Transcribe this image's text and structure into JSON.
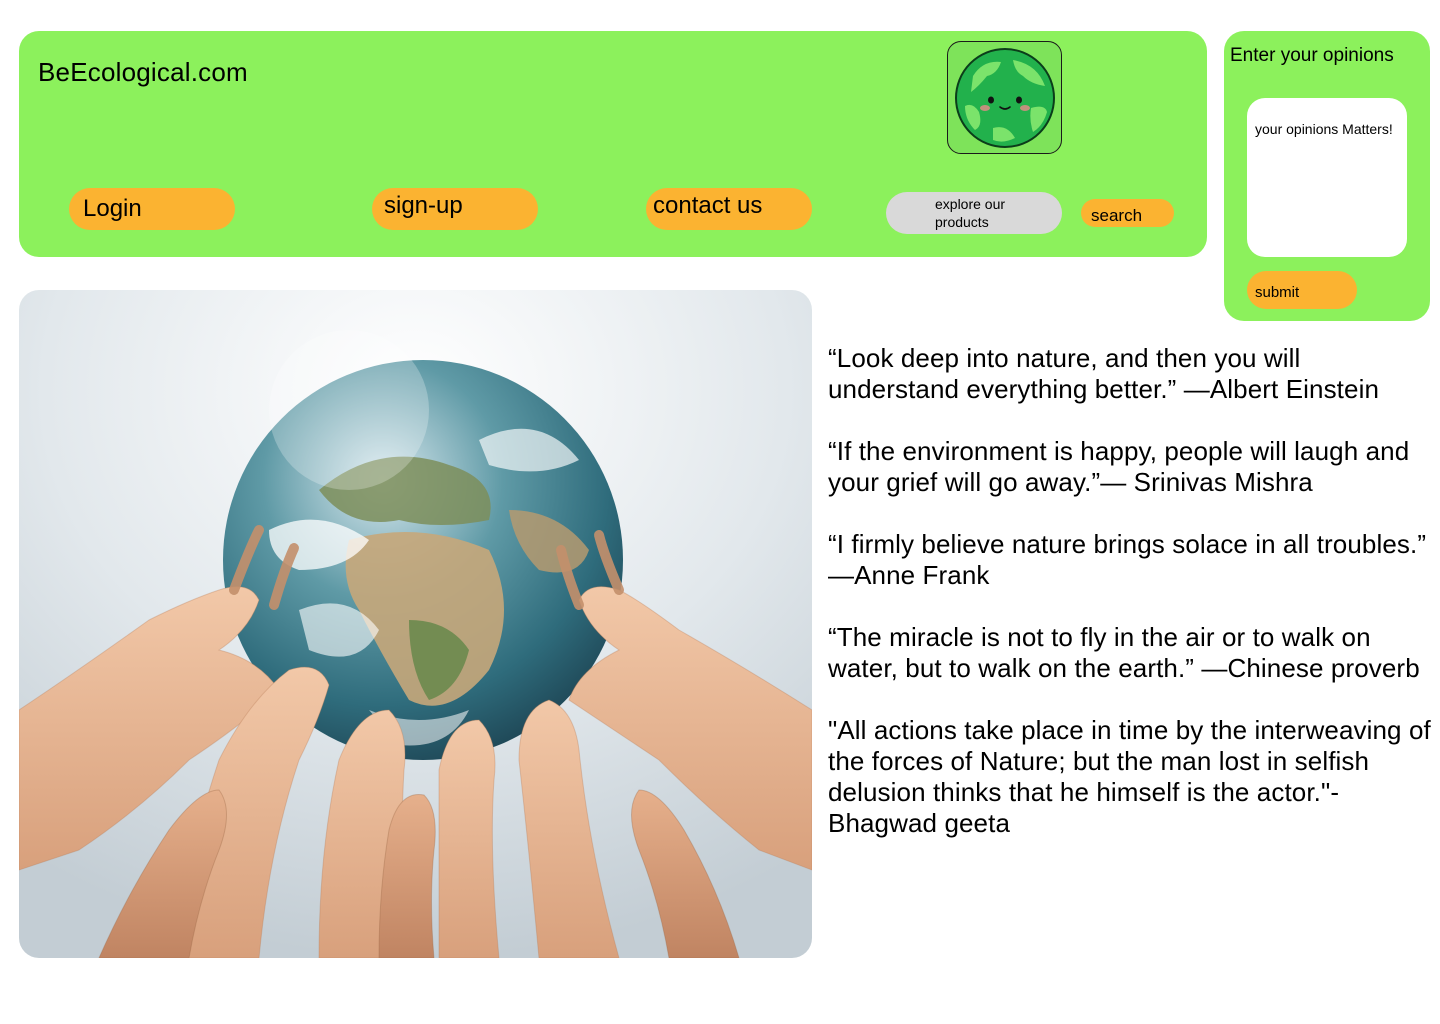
{
  "header": {
    "site_title": "BeEcological.com",
    "nav": {
      "login": "Login",
      "signup": "sign-up",
      "contact": "contact us",
      "explore": "explore our products",
      "search": "search"
    }
  },
  "opinion": {
    "title": "Enter your opinions",
    "placeholder": "your opinions Matters!",
    "submit": "submit"
  },
  "quotes": [
    "“Look deep into nature, and then you will understand everything better.” —Albert Einstein",
    "“If the environment is happy, people will laugh and your grief will go away.”— Srinivas Mishra",
    "“I firmly believe nature brings solace in all troubles.” —Anne Frank",
    "“The miracle is not to fly in the air or to walk on water, but to walk on the earth.” —Chinese proverb",
    "\"All actions take place in time by the interweaving of the forces of Nature; but the man lost in selfish delusion thinks that he himself is the actor.\"-Bhagwad geeta"
  ],
  "colors": {
    "panel": "#8cf15c",
    "button": "#fbb331",
    "explore_button": "#d9d9d9"
  },
  "icons": {
    "logo": "smiling-earth-icon"
  }
}
